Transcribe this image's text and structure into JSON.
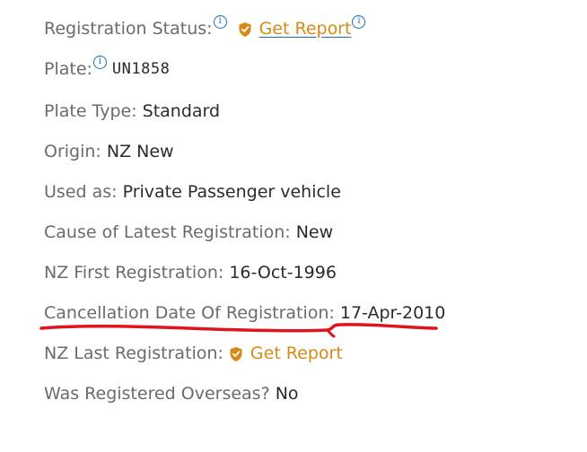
{
  "fields": [
    {
      "label": "Registration Status:",
      "link": "Get Report"
    },
    {
      "label": "Plate:",
      "value": "UN1858"
    },
    {
      "label": "Plate Type: ",
      "value": "Standard"
    },
    {
      "label": "Origin: ",
      "value": "NZ New"
    },
    {
      "label": "Used as: ",
      "value": "Private Passenger vehicle"
    },
    {
      "label": "Cause of Latest Registration: ",
      "value": "New"
    },
    {
      "label": "NZ First Registration: ",
      "value": "16-Oct-1996"
    },
    {
      "label": "Cancellation Date Of Registration: ",
      "value": "17-Apr-2010"
    },
    {
      "label": "NZ Last Registration: ",
      "link": "Get Report"
    },
    {
      "label": "Was Registered Overseas? ",
      "value": "No"
    }
  ],
  "info_icon_glyph": "i",
  "icons": [
    "info-icon",
    "shield-icon"
  ],
  "colors": {
    "label": "#6b6b6b",
    "value": "#2b2b2b",
    "link": "#d68a17",
    "info": "#1a6fb3",
    "annotation": "#e0141b"
  }
}
